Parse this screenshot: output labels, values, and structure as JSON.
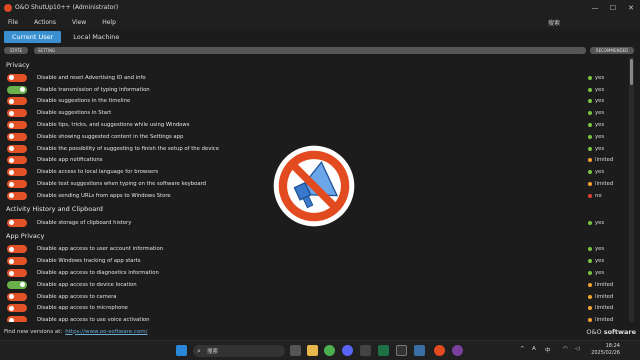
{
  "window": {
    "title": "O&O ShutUp10++ (Administrator)",
    "controls": [
      "—",
      "☐",
      "✕"
    ]
  },
  "menu": {
    "items": [
      "File",
      "Actions",
      "View",
      "Help"
    ],
    "search_label": "搜索"
  },
  "tabs": [
    {
      "label": "Current User",
      "active": true
    },
    {
      "label": "Local Machine",
      "active": false
    }
  ],
  "columns": {
    "state": "STATE",
    "setting": "SETTING",
    "recommended": "RECOMMENDED"
  },
  "sections": [
    {
      "title": "Privacy",
      "rows": [
        {
          "label": "Disable and reset Advertising ID and info",
          "on": false,
          "rec": "yes"
        },
        {
          "label": "Disable transmission of typing information",
          "on": true,
          "rec": "yes"
        },
        {
          "label": "Disable suggestions in the timeline",
          "on": false,
          "rec": "yes"
        },
        {
          "label": "Disable suggestions in Start",
          "on": false,
          "rec": "yes"
        },
        {
          "label": "Disable tips, tricks, and suggestions while using Windows",
          "on": false,
          "rec": "yes"
        },
        {
          "label": "Disable showing suggested content in the Settings app",
          "on": false,
          "rec": "yes"
        },
        {
          "label": "Disable the possibility of suggesting to finish the setup of the device",
          "on": false,
          "rec": "yes"
        },
        {
          "label": "Disable app notifications",
          "on": false,
          "rec": "limited"
        },
        {
          "label": "Disable access to local language for browsers",
          "on": false,
          "rec": "yes"
        },
        {
          "label": "Disable text suggestions when typing on the software keyboard",
          "on": false,
          "rec": "limited"
        },
        {
          "label": "Disable sending URLs from apps to Windows Store",
          "on": false,
          "rec": "no"
        }
      ]
    },
    {
      "title": "Activity History and Clipboard",
      "rows": [
        {
          "label": "Disable storage of clipboard history",
          "on": false,
          "rec": "yes"
        }
      ]
    },
    {
      "title": "App Privacy",
      "rows": [
        {
          "label": "Disable app access to user account information",
          "on": false,
          "rec": "yes"
        },
        {
          "label": "Disable Windows tracking of app starts",
          "on": false,
          "rec": "yes"
        },
        {
          "label": "Disable app access to diagnostics information",
          "on": false,
          "rec": "yes"
        },
        {
          "label": "Disable app access to device location",
          "on": true,
          "rec": "limited"
        },
        {
          "label": "Disable app access to camera",
          "on": false,
          "rec": "limited"
        },
        {
          "label": "Disable app access to microphone",
          "on": false,
          "rec": "limited"
        },
        {
          "label": "Disable app access to use voice activation",
          "on": false,
          "rec": "limited"
        }
      ]
    }
  ],
  "rec_colors": {
    "yes": "#7cc243",
    "limited": "#f0a530",
    "no": "#e0413a"
  },
  "footer": {
    "message": "Find new versions at:",
    "link": "https://www.oo-software.com/",
    "brand_prefix": "O&O",
    "brand_name": "software"
  },
  "taskbar": {
    "search_placeholder": "搜索",
    "tray_lang": "A",
    "tray_ime": "中",
    "time": "18:24",
    "date": "2025/02/26"
  }
}
